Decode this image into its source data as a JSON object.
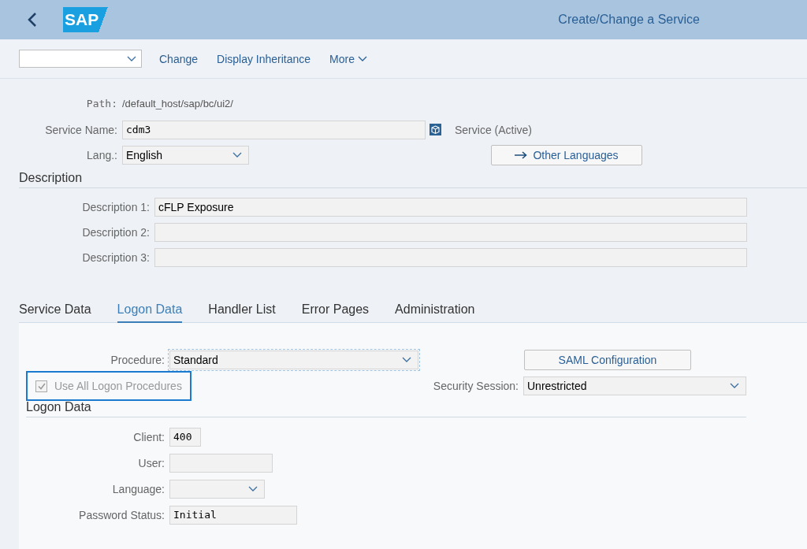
{
  "header": {
    "logo": "SAP",
    "title": "Create/Change a Service"
  },
  "toolbar": {
    "actions": [
      {
        "label": "Change",
        "menu": false
      },
      {
        "label": "Display Inheritance",
        "menu": false
      },
      {
        "label": "More",
        "menu": true
      }
    ]
  },
  "path": {
    "label": "Path:",
    "value": "/default_host/sap/bc/ui2/"
  },
  "service_name": {
    "label": "Service Name:",
    "value": "cdm3",
    "status": "Service (Active)"
  },
  "language": {
    "label": "Lang.:",
    "value": "English"
  },
  "other_languages_button": "Other Languages",
  "description": {
    "title": "Description",
    "rows": [
      {
        "label": "Description 1:",
        "value": "cFLP Exposure"
      },
      {
        "label": "Description 2:"
      },
      {
        "label": "Description 3:"
      }
    ]
  },
  "tabs": [
    {
      "label": "Service Data",
      "selected": false
    },
    {
      "label": "Logon Data",
      "selected": true
    },
    {
      "label": "Handler List",
      "selected": false
    },
    {
      "label": "Error Pages",
      "selected": false
    },
    {
      "label": "Administration",
      "selected": false
    }
  ],
  "procedure": {
    "label": "Procedure:",
    "value": "Standard"
  },
  "saml_button": "SAML Configuration",
  "use_all_logon_procedures": {
    "label": "Use All Logon Procedures",
    "checked": true,
    "disabled": true,
    "focused": true
  },
  "security_session": {
    "label": "Security Session:",
    "value": "Unrestricted"
  },
  "logon_data": {
    "title": "Logon Data",
    "fields": [
      {
        "label": "Client:",
        "value": "400",
        "kind": "text"
      },
      {
        "label": "User:",
        "kind": "text"
      },
      {
        "label": "Language:",
        "kind": "dropdown"
      },
      {
        "label": "Password Status:",
        "value": "Initial",
        "kind": "text"
      }
    ]
  }
}
